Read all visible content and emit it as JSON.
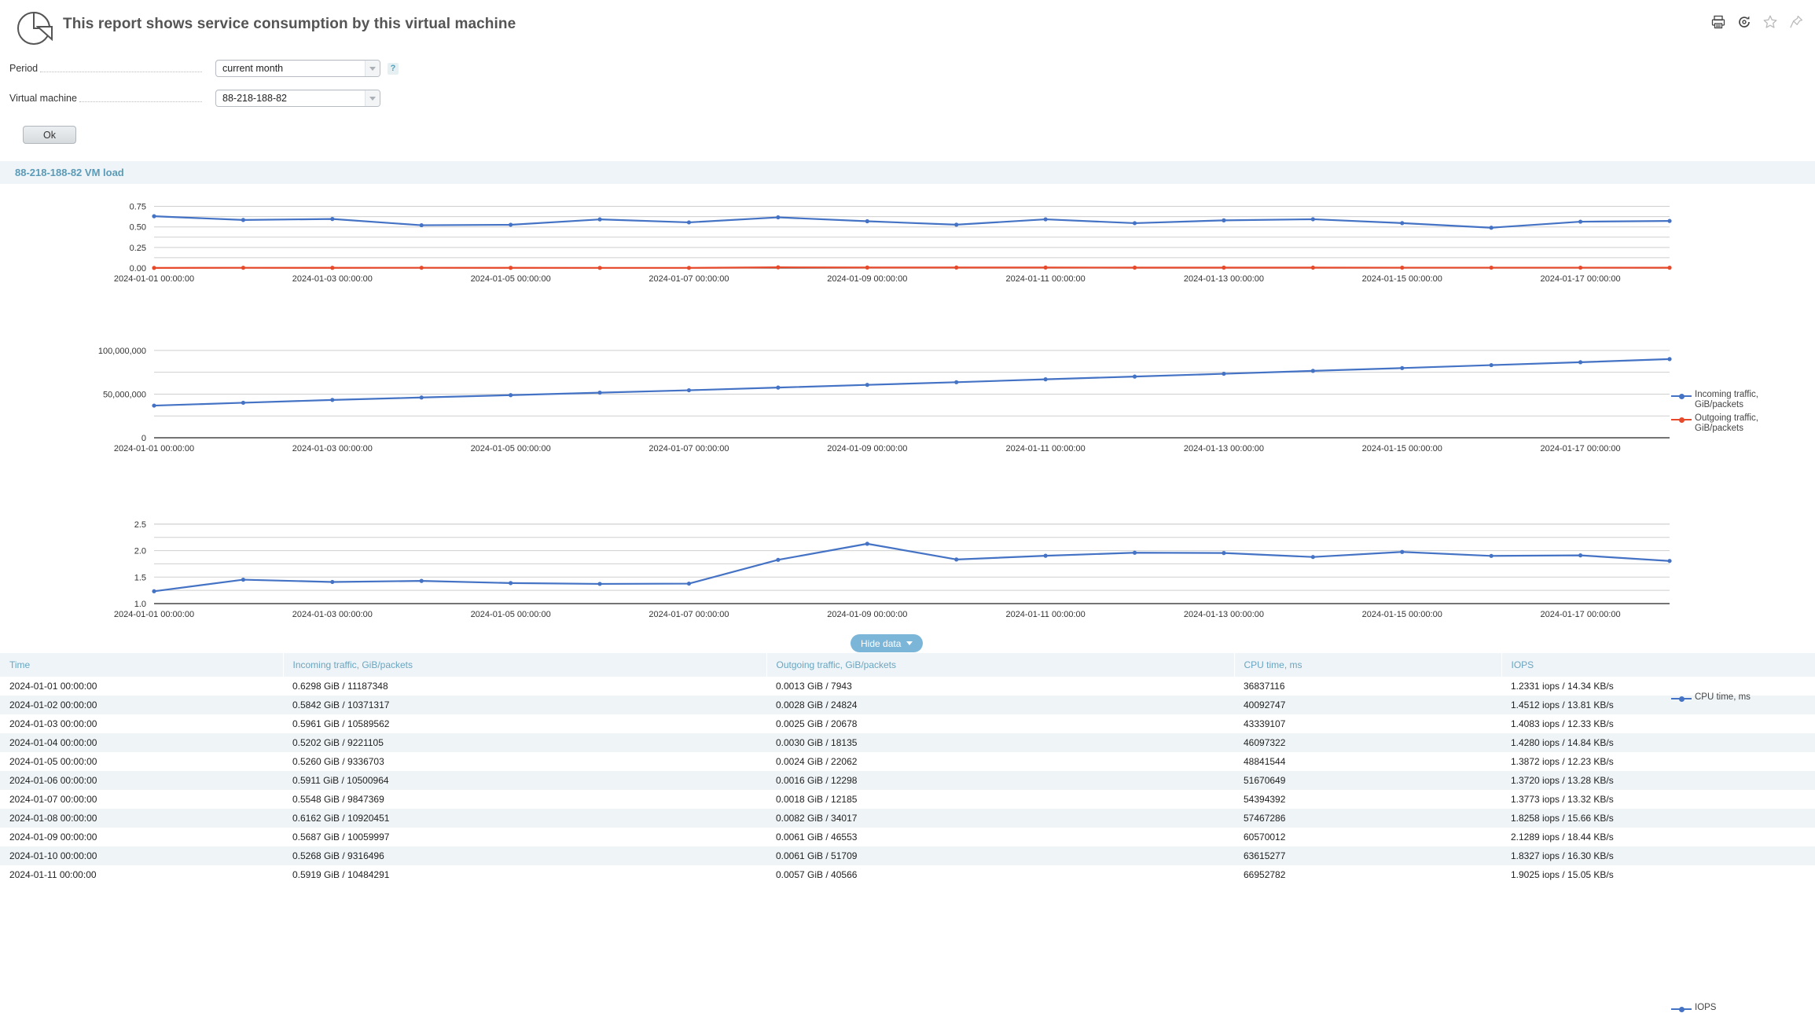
{
  "header": {
    "title": "This report shows service consumption by this virtual machine",
    "logo_icon": "pie-chart-icon",
    "actions": [
      {
        "name": "print-icon",
        "title": "Print"
      },
      {
        "name": "refresh-icon",
        "title": "Refresh"
      },
      {
        "name": "star-icon",
        "title": "Add to favorites"
      },
      {
        "name": "pin-icon",
        "title": "Pin"
      }
    ]
  },
  "filters": {
    "period": {
      "label": "Period",
      "value": "current month",
      "help": "?"
    },
    "virtual_machine": {
      "label": "Virtual machine",
      "value": "88-218-188-82"
    },
    "submit_label": "Ok"
  },
  "section": {
    "title": "88-218-188-82 VM load"
  },
  "toolbar": {
    "hide_data_label": "Hide data"
  },
  "colors": {
    "accent": "#5b9bb8",
    "series_blue": "#4472c4",
    "series_red": "#e8492b",
    "section_bg": "#eef4f7",
    "button_blue": "#7bb6d9"
  },
  "chart_data": [
    {
      "type": "line",
      "title": "",
      "xlabel": "",
      "ylabel": "",
      "grid": true,
      "legend_position": "right",
      "ylim": [
        0,
        0.8125
      ],
      "yticks": [
        0.0,
        0.25,
        0.5,
        0.75
      ],
      "ytick_labels": [
        "0.00",
        "0.25",
        "0.50",
        "0.75"
      ],
      "x": [
        "2024-01-01 00:00:00",
        "2024-01-02 00:00:00",
        "2024-01-03 00:00:00",
        "2024-01-04 00:00:00",
        "2024-01-05 00:00:00",
        "2024-01-06 00:00:00",
        "2024-01-07 00:00:00",
        "2024-01-08 00:00:00",
        "2024-01-09 00:00:00",
        "2024-01-10 00:00:00",
        "2024-01-11 00:00:00",
        "2024-01-12 00:00:00",
        "2024-01-13 00:00:00",
        "2024-01-14 00:00:00",
        "2024-01-15 00:00:00",
        "2024-01-16 00:00:00",
        "2024-01-17 00:00:00",
        "2024-01-18 00:00:00"
      ],
      "xtick_labels": [
        "2024-01-01 00:00:00",
        "2024-01-03 00:00:00",
        "2024-01-05 00:00:00",
        "2024-01-07 00:00:00",
        "2024-01-09 00:00:00",
        "2024-01-11 00:00:00",
        "2024-01-13 00:00:00",
        "2024-01-15 00:00:00",
        "2024-01-17 00:00:00"
      ],
      "series": [
        {
          "name": "Incoming traffic, GiB/packets",
          "color": "#4472c4",
          "values": [
            0.6298,
            0.5842,
            0.5961,
            0.5202,
            0.526,
            0.5911,
            0.5548,
            0.6162,
            0.5687,
            0.5268,
            0.5919,
            0.5456,
            0.5796,
            0.593,
            0.5461,
            0.49,
            0.5636,
            0.572
          ]
        },
        {
          "name": "Outgoing traffic, GiB/packets",
          "color": "#e8492b",
          "values": [
            0.0013,
            0.0028,
            0.0025,
            0.003,
            0.0024,
            0.0016,
            0.0018,
            0.0082,
            0.0061,
            0.0061,
            0.0057,
            0.005,
            0.0048,
            0.0045,
            0.0043,
            0.0041,
            0.004,
            0.0038
          ]
        }
      ]
    },
    {
      "type": "line",
      "title": "",
      "xlabel": "",
      "ylabel": "",
      "grid": true,
      "legend_position": "right",
      "ylim": [
        0,
        108000000
      ],
      "yticks": [
        0,
        50000000,
        100000000
      ],
      "ytick_labels": [
        "0",
        "50,000,000",
        "100,000,000"
      ],
      "x": [
        "2024-01-01 00:00:00",
        "2024-01-02 00:00:00",
        "2024-01-03 00:00:00",
        "2024-01-04 00:00:00",
        "2024-01-05 00:00:00",
        "2024-01-06 00:00:00",
        "2024-01-07 00:00:00",
        "2024-01-08 00:00:00",
        "2024-01-09 00:00:00",
        "2024-01-10 00:00:00",
        "2024-01-11 00:00:00",
        "2024-01-12 00:00:00",
        "2024-01-13 00:00:00",
        "2024-01-14 00:00:00",
        "2024-01-15 00:00:00",
        "2024-01-16 00:00:00",
        "2024-01-17 00:00:00",
        "2024-01-18 00:00:00"
      ],
      "xtick_labels": [
        "2024-01-01 00:00:00",
        "2024-01-03 00:00:00",
        "2024-01-05 00:00:00",
        "2024-01-07 00:00:00",
        "2024-01-09 00:00:00",
        "2024-01-11 00:00:00",
        "2024-01-13 00:00:00",
        "2024-01-15 00:00:00",
        "2024-01-17 00:00:00"
      ],
      "series": [
        {
          "name": "CPU time, ms",
          "color": "#4472c4",
          "values": [
            36837116,
            40092747,
            43339107,
            46097322,
            48841544,
            51670649,
            54394392,
            57467286,
            60570012,
            63615277,
            66952782,
            70100000,
            73300000,
            76600000,
            79800000,
            83200000,
            86500000,
            90100000
          ]
        }
      ]
    },
    {
      "type": "line",
      "title": "",
      "xlabel": "",
      "ylabel": "",
      "grid": true,
      "legend_position": "right",
      "ylim": [
        1.0,
        2.75
      ],
      "yticks": [
        1.0,
        1.5,
        2.0,
        2.5
      ],
      "ytick_labels": [
        "1.0",
        "1.5",
        "2.0",
        "2.5"
      ],
      "x": [
        "2024-01-01 00:00:00",
        "2024-01-02 00:00:00",
        "2024-01-03 00:00:00",
        "2024-01-04 00:00:00",
        "2024-01-05 00:00:00",
        "2024-01-06 00:00:00",
        "2024-01-07 00:00:00",
        "2024-01-08 00:00:00",
        "2024-01-09 00:00:00",
        "2024-01-10 00:00:00",
        "2024-01-11 00:00:00",
        "2024-01-12 00:00:00",
        "2024-01-13 00:00:00",
        "2024-01-14 00:00:00",
        "2024-01-15 00:00:00",
        "2024-01-16 00:00:00",
        "2024-01-17 00:00:00",
        "2024-01-18 00:00:00"
      ],
      "xtick_labels": [
        "2024-01-01 00:00:00",
        "2024-01-03 00:00:00",
        "2024-01-05 00:00:00",
        "2024-01-07 00:00:00",
        "2024-01-09 00:00:00",
        "2024-01-11 00:00:00",
        "2024-01-13 00:00:00",
        "2024-01-15 00:00:00",
        "2024-01-17 00:00:00"
      ],
      "series": [
        {
          "name": "IOPS",
          "color": "#4472c4",
          "values": [
            1.2331,
            1.4512,
            1.4083,
            1.428,
            1.3872,
            1.372,
            1.3773,
            1.8258,
            2.1289,
            1.8327,
            1.9025,
            1.96,
            1.955,
            1.88,
            1.975,
            1.9,
            1.91,
            1.805
          ]
        }
      ]
    }
  ],
  "table": {
    "columns": [
      "Time",
      "Incoming traffic, GiB/packets",
      "Outgoing traffic, GiB/packets",
      "CPU time, ms",
      "IOPS"
    ],
    "rows": [
      [
        "2024-01-01 00:00:00",
        "0.6298 GiB / 11187348",
        "0.0013 GiB / 7943",
        "36837116",
        "1.2331 iops / 14.34 KB/s"
      ],
      [
        "2024-01-02 00:00:00",
        "0.5842 GiB / 10371317",
        "0.0028 GiB / 24824",
        "40092747",
        "1.4512 iops / 13.81 KB/s"
      ],
      [
        "2024-01-03 00:00:00",
        "0.5961 GiB / 10589562",
        "0.0025 GiB / 20678",
        "43339107",
        "1.4083 iops / 12.33 KB/s"
      ],
      [
        "2024-01-04 00:00:00",
        "0.5202 GiB / 9221105",
        "0.0030 GiB / 18135",
        "46097322",
        "1.4280 iops / 14.84 KB/s"
      ],
      [
        "2024-01-05 00:00:00",
        "0.5260 GiB / 9336703",
        "0.0024 GiB / 22062",
        "48841544",
        "1.3872 iops / 12.23 KB/s"
      ],
      [
        "2024-01-06 00:00:00",
        "0.5911 GiB / 10500964",
        "0.0016 GiB / 12298",
        "51670649",
        "1.3720 iops / 13.28 KB/s"
      ],
      [
        "2024-01-07 00:00:00",
        "0.5548 GiB / 9847369",
        "0.0018 GiB / 12185",
        "54394392",
        "1.3773 iops / 13.32 KB/s"
      ],
      [
        "2024-01-08 00:00:00",
        "0.6162 GiB / 10920451",
        "0.0082 GiB / 34017",
        "57467286",
        "1.8258 iops / 15.66 KB/s"
      ],
      [
        "2024-01-09 00:00:00",
        "0.5687 GiB / 10059997",
        "0.0061 GiB / 46553",
        "60570012",
        "2.1289 iops / 18.44 KB/s"
      ],
      [
        "2024-01-10 00:00:00",
        "0.5268 GiB / 9316496",
        "0.0061 GiB / 51709",
        "63615277",
        "1.8327 iops / 16.30 KB/s"
      ],
      [
        "2024-01-11 00:00:00",
        "0.5919 GiB / 10484291",
        "0.0057 GiB / 40566",
        "66952782",
        "1.9025 iops / 15.05 KB/s"
      ]
    ]
  }
}
